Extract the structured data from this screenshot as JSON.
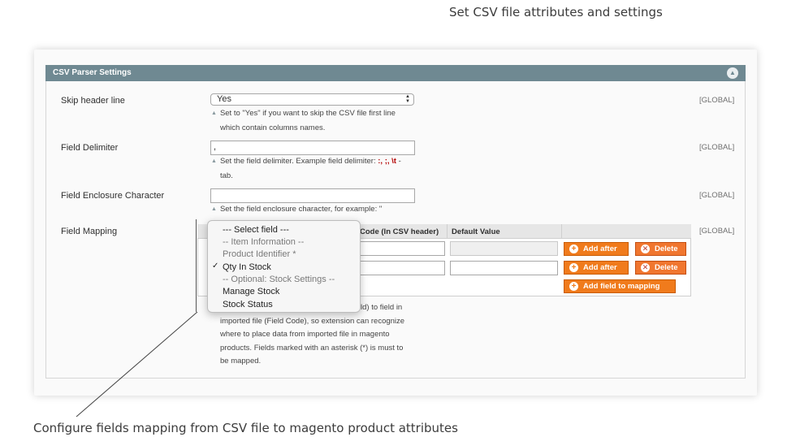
{
  "captions": {
    "top": "Set CSV file attributes and settings",
    "bottom": "Configure fields mapping from CSV file to magento product attributes"
  },
  "section": {
    "title": "CSV Parser Settings",
    "collapse_icon": "arrow-up-icon"
  },
  "fields": {
    "skip_header": {
      "label": "Skip header line",
      "value": "Yes",
      "note_1": "Set to \"Yes\" if you want to skip the CSV file first line",
      "note_2": "which contain columns names.",
      "scope": "[GLOBAL]"
    },
    "delimiter": {
      "label": "Field Delimiter",
      "value": ",",
      "note_1": "Set the field delimiter. Example field delimiter: ",
      "examples": [
        ":,",
        ";,",
        "\\t"
      ],
      "note_sep": " -",
      "note_2": "tab.",
      "scope": "[GLOBAL]"
    },
    "enclosure": {
      "label": "Field Enclosure Character",
      "value": "",
      "note_1": "Set the field enclosure character, for example: \"",
      "scope": "[GLOBAL]"
    },
    "mapping": {
      "label": "Field Mapping",
      "scope": "[GLOBAL]",
      "columns": [
        "Code (In CSV header)",
        "Default Value"
      ],
      "add_after": "Add after",
      "delete": "Delete",
      "add_field": "Add field to mapping",
      "note_lines": [
        "ld) to field in",
        "imported file (Field Code), so extension can recognize",
        "where to place data from imported file in magento",
        "products. Fields marked with an asterisk (*) is must to",
        "be mapped."
      ]
    }
  },
  "dropdown": {
    "options": [
      {
        "label": "--- Select field ---",
        "style": "normal"
      },
      {
        "label": "-- Item Information --",
        "style": "grey"
      },
      {
        "label": "Product Identifier *",
        "style": "grey"
      },
      {
        "label": "Qty In Stock",
        "style": "normal",
        "checked": true
      },
      {
        "label": "-- Optional: Stock Settings --",
        "style": "grey"
      },
      {
        "label": "Manage Stock",
        "style": "normal"
      },
      {
        "label": "Stock Status",
        "style": "normal"
      }
    ],
    "check_glyph": "✓"
  }
}
